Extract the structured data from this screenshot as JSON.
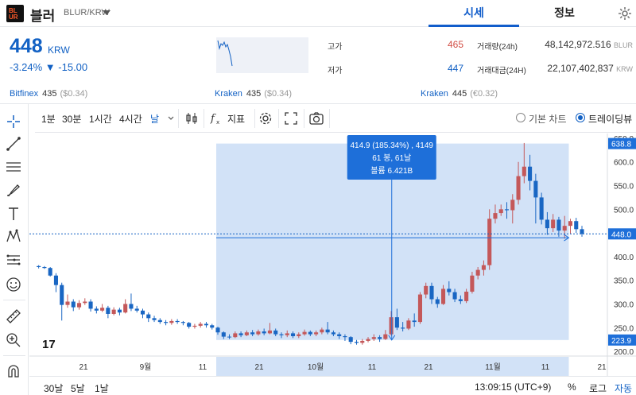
{
  "header": {
    "logo_line1": "BL",
    "logo_line2": "UR",
    "coin_name": "블러",
    "pair": "BLUR/KRW",
    "tabs": [
      {
        "label": "시세",
        "active": true
      },
      {
        "label": "정보",
        "active": false
      }
    ]
  },
  "summary": {
    "price": "448",
    "unit": "KRW",
    "change": "-3.24% ▼ -15.00",
    "high_label": "고가",
    "high_value": "465",
    "low_label": "저가",
    "low_value": "447",
    "volume_label": "거래량(24h)",
    "volume_value": "48,142,972.516",
    "volume_unit": "BLUR",
    "amount_label": "거래대금(24H)",
    "amount_value": "22,107,402,837",
    "amount_unit": "KRW"
  },
  "exchanges": [
    {
      "name": "Bitfinex",
      "price": "435",
      "diff": "($0.34)"
    },
    {
      "name": "Kraken",
      "price": "435",
      "diff": "($0.34)"
    },
    {
      "name": "Kraken",
      "price": "445",
      "diff": "(€0.32)"
    }
  ],
  "toolbar": {
    "intervals": [
      {
        "label": "1분",
        "active": false
      },
      {
        "label": "30분",
        "active": false
      },
      {
        "label": "1시간",
        "active": false
      },
      {
        "label": "4시간",
        "active": false
      },
      {
        "label": "날",
        "active": true
      }
    ],
    "indicator_label": "지표",
    "basic_chart_label": "기본 차트",
    "trading_view_label": "트레이딩뷰",
    "selected_chart": "트레이딩뷰"
  },
  "tooltip": {
    "line1": "414.9 (185.34%) , 4149",
    "line2": "61 봉, 61날",
    "line3": "볼륨 6.421B"
  },
  "chart_data": {
    "type": "candlestick",
    "y_ticks": [
      "650.0",
      "600.0",
      "550.0",
      "500.0",
      "450.0",
      "400.0",
      "350.0",
      "300.0",
      "250.0",
      "200.0"
    ],
    "ylim": [
      190,
      660
    ],
    "x_ticks": [
      "21",
      "9월",
      "11",
      "21",
      "10월",
      "11",
      "21",
      "11월",
      "11",
      "21"
    ],
    "price_label": "448.0",
    "range_high_label": "638.8",
    "range_low_label": "223.9",
    "logo_text": "17",
    "colors": {
      "up": "#c4585a",
      "down": "#1966c3",
      "highlight": "#1e6fd9"
    },
    "candles": [
      [
        380,
        378,
        382,
        375
      ],
      [
        378,
        376,
        380,
        374
      ],
      [
        376,
        360,
        378,
        358
      ],
      [
        360,
        340,
        365,
        325
      ],
      [
        340,
        298,
        345,
        265
      ],
      [
        298,
        305,
        320,
        292
      ],
      [
        305,
        293,
        310,
        285
      ],
      [
        293,
        302,
        308,
        288
      ],
      [
        302,
        305,
        312,
        298
      ],
      [
        305,
        290,
        310,
        284
      ],
      [
        290,
        286,
        295,
        280
      ],
      [
        286,
        292,
        300,
        283
      ],
      [
        292,
        279,
        296,
        270
      ],
      [
        279,
        288,
        293,
        276
      ],
      [
        288,
        282,
        292,
        276
      ],
      [
        282,
        300,
        310,
        280
      ],
      [
        300,
        290,
        322,
        285
      ],
      [
        290,
        286,
        296,
        282
      ],
      [
        286,
        278,
        290,
        270
      ],
      [
        278,
        270,
        282,
        262
      ],
      [
        270,
        266,
        275,
        262
      ],
      [
        266,
        262,
        270,
        258
      ],
      [
        262,
        260,
        266,
        255
      ],
      [
        260,
        264,
        268,
        256
      ],
      [
        264,
        262,
        268,
        258
      ],
      [
        262,
        260,
        264,
        255
      ],
      [
        260,
        252,
        262,
        248
      ],
      [
        252,
        254,
        258,
        248
      ],
      [
        254,
        258,
        262,
        250
      ],
      [
        258,
        255,
        262,
        250
      ],
      [
        255,
        250,
        258,
        246
      ],
      [
        250,
        240,
        252,
        235
      ],
      [
        240,
        231,
        242,
        226
      ],
      [
        231,
        230,
        236,
        226
      ],
      [
        230,
        238,
        242,
        228
      ],
      [
        238,
        234,
        242,
        230
      ],
      [
        234,
        240,
        244,
        232
      ],
      [
        240,
        236,
        245,
        232
      ],
      [
        236,
        242,
        246,
        233
      ],
      [
        242,
        238,
        248,
        234
      ],
      [
        238,
        244,
        260,
        236
      ],
      [
        244,
        236,
        248,
        232
      ],
      [
        236,
        234,
        240,
        228
      ],
      [
        234,
        238,
        244,
        230
      ],
      [
        238,
        232,
        242,
        228
      ],
      [
        232,
        236,
        240,
        228
      ],
      [
        236,
        241,
        246,
        233
      ],
      [
        241,
        236,
        244,
        232
      ],
      [
        236,
        240,
        244,
        232
      ],
      [
        240,
        246,
        250,
        236
      ],
      [
        246,
        240,
        262,
        236
      ],
      [
        240,
        236,
        244,
        232
      ],
      [
        236,
        232,
        240,
        226
      ],
      [
        232,
        230,
        236,
        222
      ],
      [
        230,
        220,
        232,
        215
      ],
      [
        220,
        218,
        224,
        214
      ],
      [
        218,
        222,
        226,
        214
      ],
      [
        222,
        226,
        230,
        219
      ],
      [
        226,
        230,
        236,
        222
      ],
      [
        230,
        226,
        234,
        220
      ],
      [
        226,
        236,
        245,
        224
      ],
      [
        236,
        272,
        285,
        233
      ],
      [
        272,
        250,
        290,
        245
      ],
      [
        250,
        248,
        262,
        242
      ],
      [
        248,
        265,
        270,
        245
      ],
      [
        265,
        262,
        280,
        252
      ],
      [
        262,
        320,
        325,
        258
      ],
      [
        320,
        338,
        345,
        312
      ],
      [
        338,
        310,
        345,
        300
      ],
      [
        310,
        300,
        315,
        292
      ],
      [
        300,
        332,
        340,
        298
      ],
      [
        332,
        325,
        348,
        318
      ],
      [
        325,
        310,
        332,
        304
      ],
      [
        310,
        306,
        318,
        300
      ],
      [
        306,
        326,
        332,
        302
      ],
      [
        326,
        360,
        368,
        322
      ],
      [
        360,
        372,
        378,
        352
      ],
      [
        372,
        382,
        392,
        360
      ],
      [
        382,
        480,
        500,
        372
      ],
      [
        480,
        492,
        510,
        470
      ],
      [
        492,
        500,
        510,
        486
      ],
      [
        500,
        498,
        515,
        480
      ],
      [
        498,
        520,
        532,
        470
      ],
      [
        520,
        570,
        600,
        510
      ],
      [
        570,
        590,
        640,
        555
      ],
      [
        590,
        560,
        615,
        540
      ],
      [
        560,
        525,
        575,
        470
      ],
      [
        525,
        478,
        535,
        468
      ],
      [
        478,
        460,
        494,
        446
      ],
      [
        460,
        478,
        490,
        452
      ],
      [
        478,
        455,
        484,
        442
      ],
      [
        455,
        465,
        486,
        438
      ],
      [
        465,
        475,
        480,
        448
      ],
      [
        475,
        458,
        482,
        450
      ],
      [
        458,
        448,
        465,
        442
      ]
    ]
  }
}
